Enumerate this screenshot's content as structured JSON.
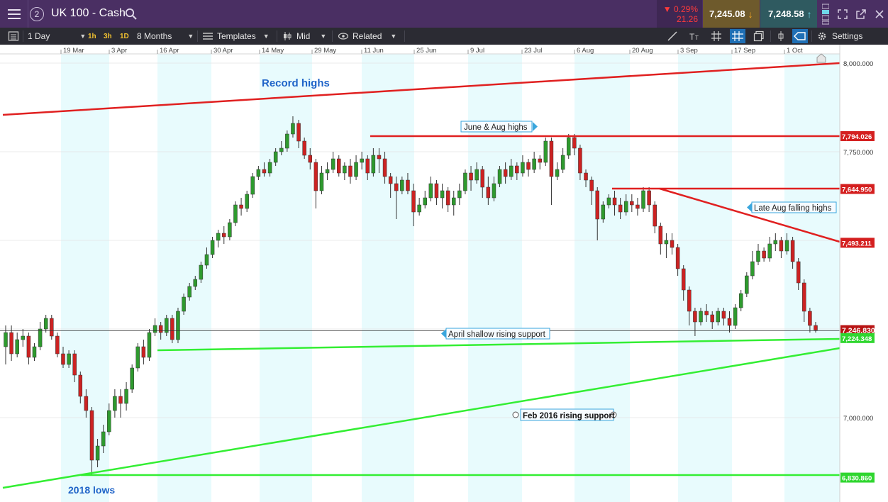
{
  "header": {
    "badge": "2",
    "title": "UK 100 - Cash",
    "change_pct": "▼ 0.29%",
    "change_abs": "21.26",
    "sell_price": "7,245.08",
    "buy_price": "7,248.58"
  },
  "toolbar": {
    "interval": "1 Day",
    "quick_1h": "1h",
    "quick_3h": "3h",
    "quick_1d": "1D",
    "range": "8 Months",
    "templates": "Templates",
    "price_type": "Mid",
    "related": "Related",
    "settings": "Settings"
  },
  "colors": {
    "title_bg": "#4a2f63",
    "toolbar_bg": "#2b2b33",
    "up_candle": "#2e9a2e",
    "down_candle": "#cc2222",
    "resistance": "#e02020",
    "support": "#33ee33",
    "band": "#e8fbfd",
    "annotation_blue": "#1f64c8"
  },
  "chart_data": {
    "type": "candlestick",
    "instrument": "UK 100 - Cash",
    "x_ticks": [
      "19 Mar",
      "3 Apr",
      "16 Apr",
      "30 Apr",
      "14 May",
      "29 May",
      "11 Jun",
      "25 Jun",
      "9 Jul",
      "23 Jul",
      "6 Aug",
      "20 Aug",
      "3 Sep",
      "17 Sep",
      "1 Oct"
    ],
    "y_ticks": [
      "8,000.000",
      "7,750.000",
      "7,000.000"
    ],
    "ylim": [
      6800,
      8050
    ],
    "levels": [
      {
        "label": "7,794.026",
        "value": 7794.026,
        "kind": "resistance"
      },
      {
        "label": "7,644.950",
        "value": 7644.95,
        "kind": "resistance"
      },
      {
        "label": "7,493.211",
        "value": 7493.211,
        "kind": "resistance"
      },
      {
        "label": "7,246.830",
        "value": 7246.83,
        "kind": "current"
      },
      {
        "label": "7,224.348",
        "value": 7224.348,
        "kind": "support"
      },
      {
        "label": "6,830.860",
        "value": 6830.86,
        "kind": "support"
      }
    ],
    "annotations": [
      {
        "text": "Record highs",
        "style": "title"
      },
      {
        "text": "June & Aug highs",
        "style": "box"
      },
      {
        "text": "Late Aug falling highs",
        "style": "box"
      },
      {
        "text": "April shallow rising support",
        "style": "box"
      },
      {
        "text": "Feb 2016 rising support",
        "style": "box"
      },
      {
        "text": "2018 lows",
        "style": "title"
      }
    ],
    "candles": [
      [
        7200,
        7240,
        7150,
        7260
      ],
      [
        7240,
        7180,
        7160,
        7260
      ],
      [
        7180,
        7220,
        7170,
        7240
      ],
      [
        7220,
        7230,
        7200,
        7250
      ],
      [
        7230,
        7170,
        7150,
        7240
      ],
      [
        7170,
        7200,
        7160,
        7210
      ],
      [
        7200,
        7250,
        7190,
        7270
      ],
      [
        7250,
        7280,
        7240,
        7290
      ],
      [
        7280,
        7230,
        7220,
        7290
      ],
      [
        7230,
        7180,
        7170,
        7240
      ],
      [
        7180,
        7150,
        7140,
        7200
      ],
      [
        7150,
        7180,
        7140,
        7190
      ],
      [
        7180,
        7120,
        7100,
        7190
      ],
      [
        7120,
        7060,
        7040,
        7130
      ],
      [
        7060,
        7020,
        7000,
        7080
      ],
      [
        7020,
        6880,
        6840,
        7030
      ],
      [
        6880,
        6920,
        6860,
        6940
      ],
      [
        6920,
        6960,
        6900,
        6980
      ],
      [
        6960,
        7020,
        6950,
        7040
      ],
      [
        7020,
        7060,
        7000,
        7080
      ],
      [
        7060,
        7040,
        7000,
        7080
      ],
      [
        7040,
        7080,
        7020,
        7100
      ],
      [
        7080,
        7140,
        7070,
        7150
      ],
      [
        7140,
        7200,
        7130,
        7210
      ],
      [
        7200,
        7170,
        7150,
        7220
      ],
      [
        7170,
        7240,
        7160,
        7250
      ],
      [
        7240,
        7260,
        7230,
        7280
      ],
      [
        7260,
        7240,
        7220,
        7270
      ],
      [
        7240,
        7280,
        7230,
        7290
      ],
      [
        7280,
        7220,
        7210,
        7290
      ],
      [
        7220,
        7300,
        7210,
        7310
      ],
      [
        7300,
        7340,
        7290,
        7350
      ],
      [
        7340,
        7370,
        7330,
        7380
      ],
      [
        7370,
        7390,
        7360,
        7400
      ],
      [
        7390,
        7430,
        7380,
        7440
      ],
      [
        7430,
        7460,
        7420,
        7480
      ],
      [
        7460,
        7500,
        7450,
        7510
      ],
      [
        7500,
        7520,
        7480,
        7530
      ],
      [
        7520,
        7510,
        7490,
        7540
      ],
      [
        7510,
        7550,
        7500,
        7560
      ],
      [
        7550,
        7600,
        7540,
        7610
      ],
      [
        7600,
        7590,
        7570,
        7620
      ],
      [
        7590,
        7630,
        7580,
        7640
      ],
      [
        7630,
        7680,
        7620,
        7690
      ],
      [
        7680,
        7700,
        7670,
        7710
      ],
      [
        7700,
        7690,
        7680,
        7720
      ],
      [
        7690,
        7720,
        7680,
        7730
      ],
      [
        7720,
        7750,
        7710,
        7760
      ],
      [
        7750,
        7760,
        7740,
        7780
      ],
      [
        7760,
        7800,
        7750,
        7810
      ],
      [
        7800,
        7830,
        7790,
        7850
      ],
      [
        7830,
        7780,
        7760,
        7840
      ],
      [
        7780,
        7740,
        7730,
        7790
      ],
      [
        7740,
        7720,
        7700,
        7760
      ],
      [
        7720,
        7640,
        7590,
        7730
      ],
      [
        7640,
        7690,
        7630,
        7710
      ],
      [
        7690,
        7700,
        7670,
        7720
      ],
      [
        7700,
        7730,
        7690,
        7750
      ],
      [
        7730,
        7690,
        7680,
        7740
      ],
      [
        7690,
        7710,
        7670,
        7720
      ],
      [
        7710,
        7680,
        7660,
        7730
      ],
      [
        7680,
        7720,
        7670,
        7740
      ],
      [
        7720,
        7730,
        7700,
        7750
      ],
      [
        7730,
        7690,
        7670,
        7740
      ],
      [
        7690,
        7740,
        7680,
        7760
      ],
      [
        7740,
        7730,
        7690,
        7760
      ],
      [
        7730,
        7680,
        7660,
        7750
      ],
      [
        7680,
        7660,
        7620,
        7690
      ],
      [
        7660,
        7640,
        7560,
        7680
      ],
      [
        7640,
        7670,
        7630,
        7680
      ],
      [
        7670,
        7640,
        7630,
        7690
      ],
      [
        7640,
        7580,
        7540,
        7660
      ],
      [
        7580,
        7600,
        7570,
        7620
      ],
      [
        7600,
        7620,
        7590,
        7640
      ],
      [
        7620,
        7660,
        7610,
        7680
      ],
      [
        7660,
        7620,
        7600,
        7670
      ],
      [
        7620,
        7640,
        7590,
        7660
      ],
      [
        7640,
        7600,
        7580,
        7650
      ],
      [
        7600,
        7620,
        7570,
        7640
      ],
      [
        7620,
        7640,
        7600,
        7660
      ],
      [
        7640,
        7690,
        7630,
        7700
      ],
      [
        7690,
        7670,
        7640,
        7710
      ],
      [
        7670,
        7700,
        7660,
        7720
      ],
      [
        7700,
        7650,
        7620,
        7710
      ],
      [
        7650,
        7620,
        7600,
        7680
      ],
      [
        7620,
        7660,
        7610,
        7680
      ],
      [
        7660,
        7700,
        7650,
        7710
      ],
      [
        7700,
        7680,
        7660,
        7720
      ],
      [
        7680,
        7710,
        7670,
        7730
      ],
      [
        7710,
        7690,
        7670,
        7720
      ],
      [
        7690,
        7720,
        7680,
        7740
      ],
      [
        7720,
        7700,
        7680,
        7730
      ],
      [
        7700,
        7730,
        7690,
        7750
      ],
      [
        7730,
        7720,
        7700,
        7740
      ],
      [
        7720,
        7780,
        7710,
        7790
      ],
      [
        7780,
        7680,
        7600,
        7790
      ],
      [
        7680,
        7700,
        7670,
        7720
      ],
      [
        7700,
        7740,
        7690,
        7760
      ],
      [
        7740,
        7790,
        7730,
        7800
      ],
      [
        7790,
        7760,
        7740,
        7800
      ],
      [
        7760,
        7690,
        7670,
        7770
      ],
      [
        7690,
        7670,
        7650,
        7700
      ],
      [
        7670,
        7640,
        7600,
        7680
      ],
      [
        7640,
        7560,
        7500,
        7650
      ],
      [
        7560,
        7600,
        7550,
        7610
      ],
      [
        7600,
        7620,
        7590,
        7630
      ],
      [
        7620,
        7600,
        7570,
        7640
      ],
      [
        7600,
        7580,
        7560,
        7620
      ],
      [
        7580,
        7610,
        7570,
        7630
      ],
      [
        7610,
        7600,
        7580,
        7630
      ],
      [
        7600,
        7590,
        7570,
        7620
      ],
      [
        7590,
        7640,
        7580,
        7650
      ],
      [
        7640,
        7600,
        7580,
        7650
      ],
      [
        7600,
        7540,
        7520,
        7610
      ],
      [
        7540,
        7490,
        7460,
        7550
      ],
      [
        7490,
        7500,
        7450,
        7520
      ],
      [
        7500,
        7480,
        7460,
        7520
      ],
      [
        7480,
        7420,
        7400,
        7490
      ],
      [
        7420,
        7360,
        7330,
        7430
      ],
      [
        7360,
        7300,
        7260,
        7370
      ],
      [
        7300,
        7270,
        7230,
        7310
      ],
      [
        7270,
        7300,
        7260,
        7310
      ],
      [
        7300,
        7290,
        7270,
        7320
      ],
      [
        7290,
        7270,
        7250,
        7300
      ],
      [
        7270,
        7300,
        7260,
        7310
      ],
      [
        7300,
        7280,
        7260,
        7310
      ],
      [
        7280,
        7260,
        7240,
        7300
      ],
      [
        7260,
        7310,
        7250,
        7320
      ],
      [
        7310,
        7350,
        7300,
        7360
      ],
      [
        7350,
        7400,
        7340,
        7410
      ],
      [
        7400,
        7440,
        7390,
        7470
      ],
      [
        7440,
        7470,
        7430,
        7490
      ],
      [
        7470,
        7450,
        7440,
        7480
      ],
      [
        7450,
        7490,
        7440,
        7510
      ],
      [
        7490,
        7500,
        7470,
        7520
      ],
      [
        7500,
        7470,
        7450,
        7510
      ],
      [
        7470,
        7500,
        7460,
        7520
      ],
      [
        7500,
        7440,
        7420,
        7510
      ],
      [
        7440,
        7380,
        7360,
        7450
      ],
      [
        7380,
        7300,
        7270,
        7390
      ],
      [
        7300,
        7260,
        7240,
        7310
      ],
      [
        7260,
        7247,
        7240,
        7270
      ]
    ]
  }
}
